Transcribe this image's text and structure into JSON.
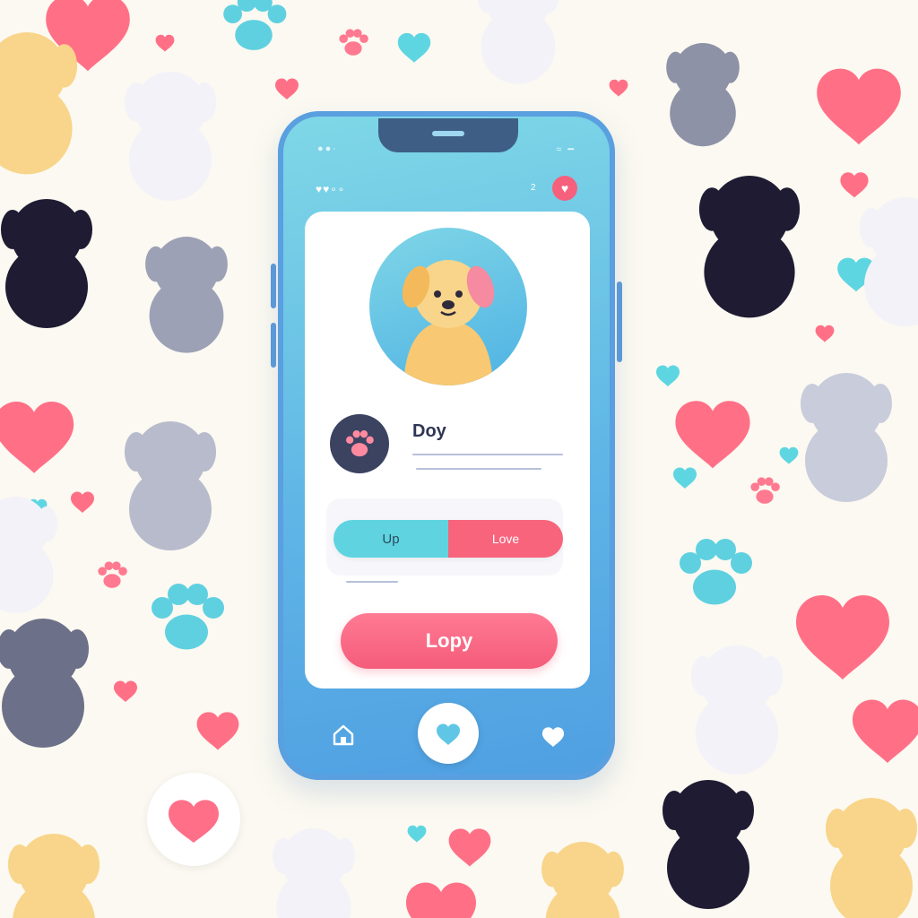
{
  "app": {
    "status_left": "●●∙",
    "status_right": "≈ ━",
    "bar_left": "♥♥∘∘",
    "bar_count": "2",
    "notification_icon": "heart-icon"
  },
  "profile": {
    "avatar_icon": "dog-avatar-icon",
    "badge_icon": "paw-icon",
    "name": "Doy"
  },
  "toggle": {
    "left_label": "Up",
    "right_label": "Love"
  },
  "cta": {
    "label": "Lopy"
  },
  "nav": {
    "home_icon": "home-icon",
    "center_icon": "heart-icon",
    "right_icon": "heart-icon"
  },
  "colors": {
    "pink": "#f7647c",
    "teal": "#5fd4e0",
    "phone_blue": "#5fb6e6",
    "background": "#fbf9f1",
    "dark": "#2f3655"
  }
}
